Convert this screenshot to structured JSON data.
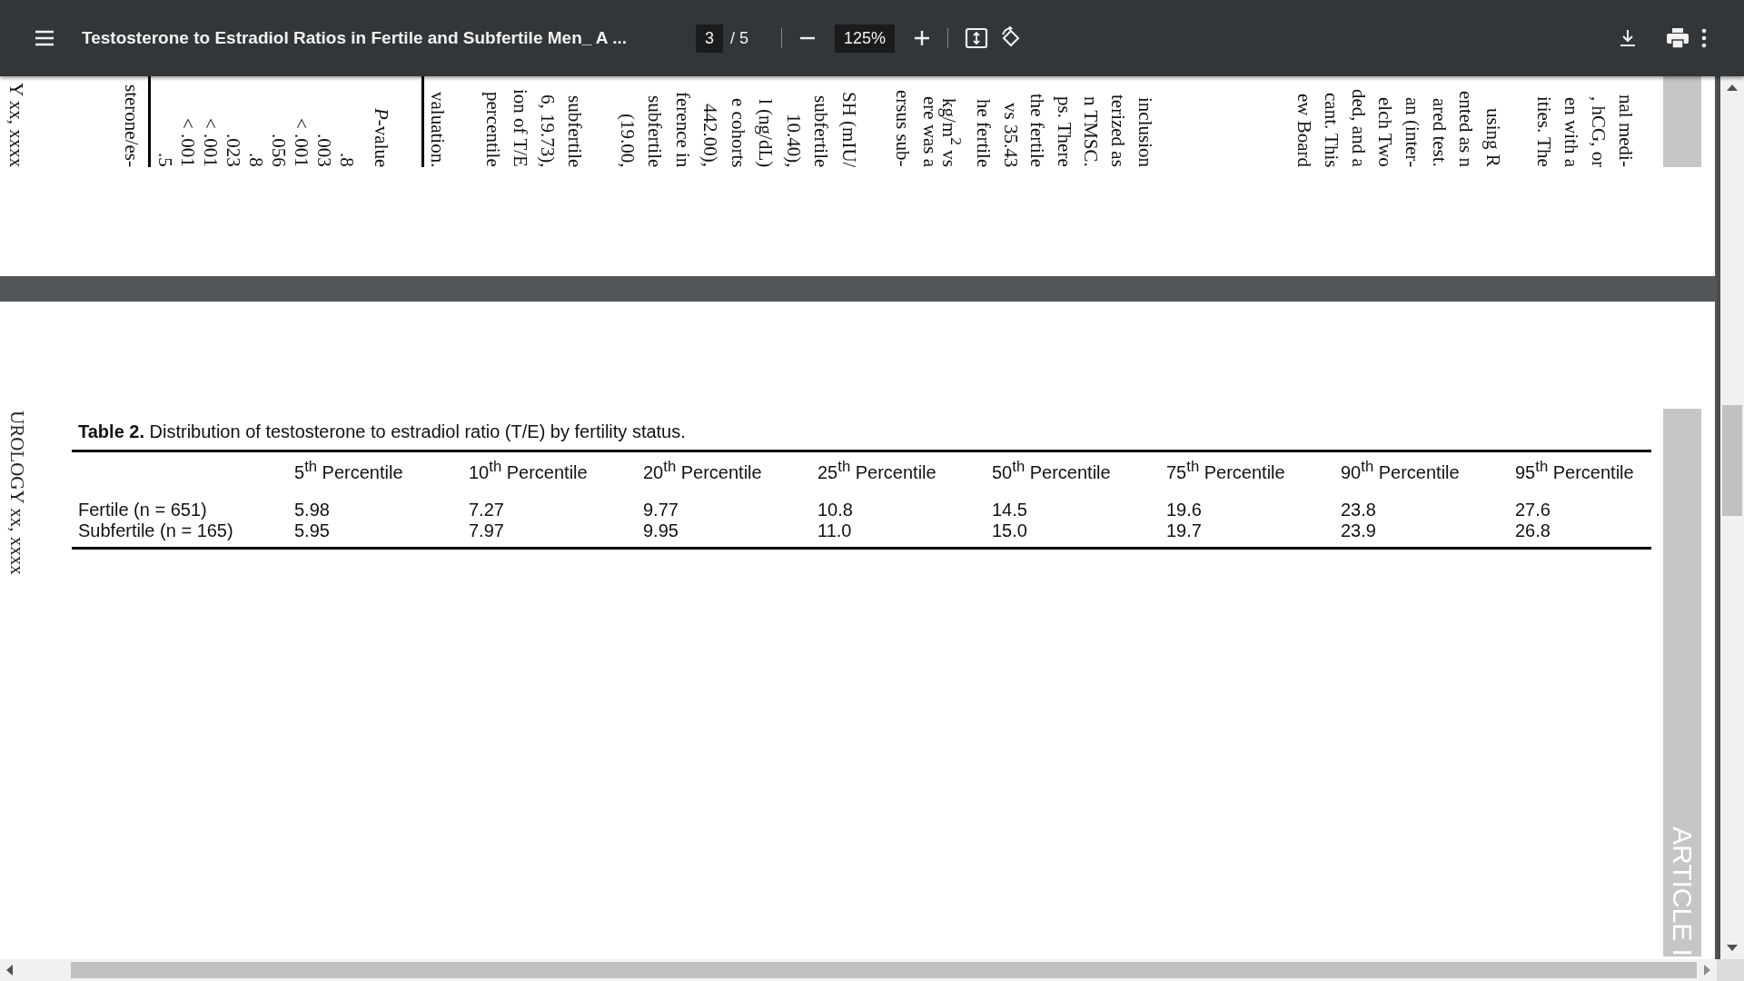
{
  "toolbar": {
    "title": "Testosterone to Estradiol Ratios in Fertile and Subfertile Men_ A ...",
    "page_input": "3",
    "page_total": "/ 5",
    "zoom": "125%"
  },
  "previous_page": {
    "strip": [
      {
        "kind": "lines",
        "lines": [
          "Y xx, xxxx"
        ]
      },
      {
        "kind": "lines",
        "lines": [
          "sterone/es-"
        ]
      },
      {
        "kind": "rule"
      },
      {
        "kind": "lines",
        "lines": [
          ".5",
          "< .001",
          "< .001",
          ".023",
          ".8",
          ".056",
          "< .001",
          ".003",
          ".8"
        ]
      },
      {
        "kind": "lines",
        "lines": [
          "*P*-value"
        ]
      },
      {
        "kind": "rule"
      },
      {
        "kind": "lines",
        "lines": [
          "valuation."
        ]
      },
      {
        "kind": "lines",
        "lines": [
          "percentile",
          "ion of T/E",
          "6, 19.73),",
          "subfertile"
        ]
      },
      {
        "kind": "lines",
        "lines": [
          "(19.00,",
          "subfertile",
          "ference in",
          "442.00),",
          "e cohorts",
          "l (ng/dL)",
          "10.40),",
          "subfertile",
          "SH (mIU/"
        ]
      },
      {
        "kind": "lines",
        "lines": [
          "ersus sub-",
          "ere was a",
          "kg/m$^{2}$ vs",
          "he fertile",
          "vs 35.43",
          "the fertile",
          "ps. There",
          "n TMSC.",
          "terized as",
          "inclusion"
        ]
      },
      {
        "kind": "lines",
        "lines": [
          "ew Board",
          "cant. This",
          "ded, and a",
          "elch Two",
          "an (inter-",
          "ared test.",
          "ented as n",
          "using R"
        ]
      },
      {
        "kind": "lines",
        "lines": [
          "ities. The",
          "en with a",
          ", hCG, or",
          "nal medi-"
        ]
      }
    ]
  },
  "page": {
    "running_head": "UROLOGY xx, xxxx",
    "table": {
      "caption": "**Table 2.** Distribution of testosterone to estradiol ratio (T/E) by fertility status.",
      "columns": [
        "5$^{th}$ Percentile",
        "10$^{th}$ Percentile",
        "20$^{th}$ Percentile",
        "25$^{th}$ Percentile",
        "50$^{th}$ Percentile",
        "75$^{th}$ Percentile",
        "90$^{th}$ Percentile",
        "95$^{th}$ Percentile"
      ],
      "rows": [
        {
          "label": "Fertile (n = 651)",
          "values": [
            "5.98",
            "7.27",
            "9.77",
            "10.8",
            "14.5",
            "19.6",
            "23.8",
            "27.6"
          ]
        },
        {
          "label": "Subfertile (n = 165)",
          "values": [
            "5.95",
            "7.97",
            "9.95",
            "11.0",
            "15.0",
            "19.7",
            "23.9",
            "26.8"
          ]
        }
      ]
    },
    "side_tab": "ARTICLE I"
  }
}
